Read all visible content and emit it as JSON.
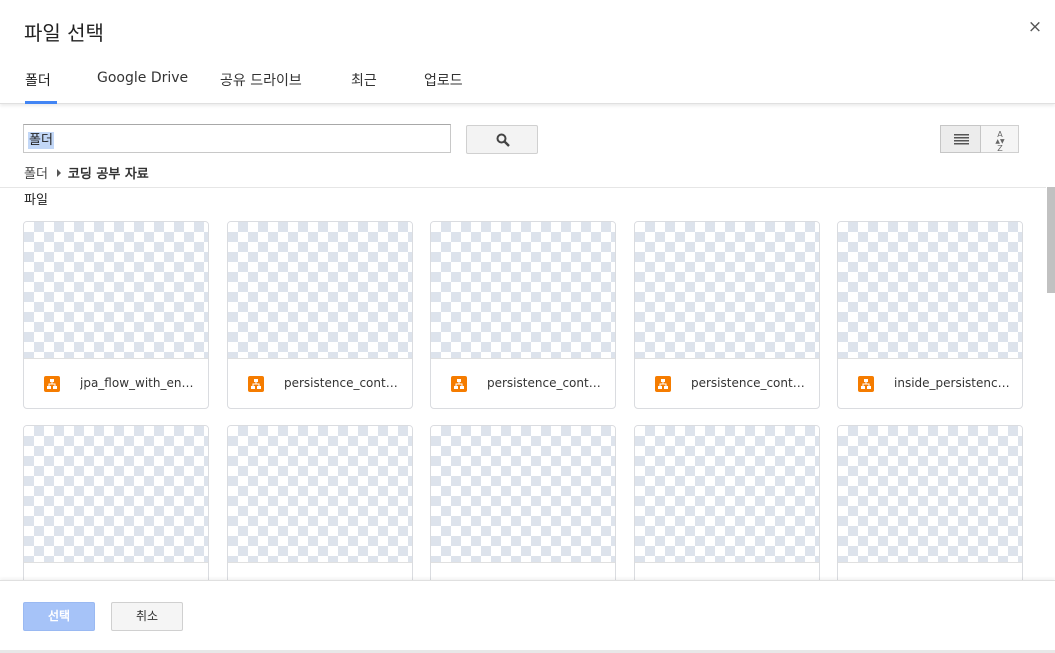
{
  "dialog": {
    "title": "파일 선택",
    "close_symbol": "×"
  },
  "tabs": [
    {
      "label": "폴더",
      "active": true
    },
    {
      "label": "Google Drive",
      "active": false
    },
    {
      "label": "공유 드라이브",
      "active": false
    },
    {
      "label": "최근",
      "active": false
    },
    {
      "label": "업로드",
      "active": false
    }
  ],
  "search": {
    "value": "폴더",
    "button_icon": "search-icon"
  },
  "view_controls": {
    "list_icon": "list-view-icon",
    "sort_icon": "sort-az-icon",
    "sort_label_top": "A",
    "sort_label_bottom": "Z"
  },
  "breadcrumb": {
    "root": "폴더",
    "current": "코딩 공부 자료"
  },
  "section": {
    "label": "파일"
  },
  "files": [
    {
      "name": "jpa_flow_with_entity",
      "icon": "diagram-file-icon"
    },
    {
      "name": "persistence_context",
      "icon": "diagram-file-icon"
    },
    {
      "name": "persistence_context",
      "icon": "diagram-file-icon"
    },
    {
      "name": "persistence_context",
      "icon": "diagram-file-icon"
    },
    {
      "name": "inside_persistence_context",
      "icon": "diagram-file-icon"
    },
    {
      "name": "",
      "icon": "diagram-file-icon"
    },
    {
      "name": "",
      "icon": "diagram-file-icon"
    },
    {
      "name": "",
      "icon": "diagram-file-icon"
    },
    {
      "name": "",
      "icon": "diagram-file-icon"
    },
    {
      "name": "",
      "icon": "diagram-file-icon"
    }
  ],
  "footer": {
    "select_label": "선택",
    "cancel_label": "취소"
  },
  "colors": {
    "accent": "#4285f4",
    "select_button_disabled": "#a6c3f8",
    "file_icon": "#f57c00"
  }
}
